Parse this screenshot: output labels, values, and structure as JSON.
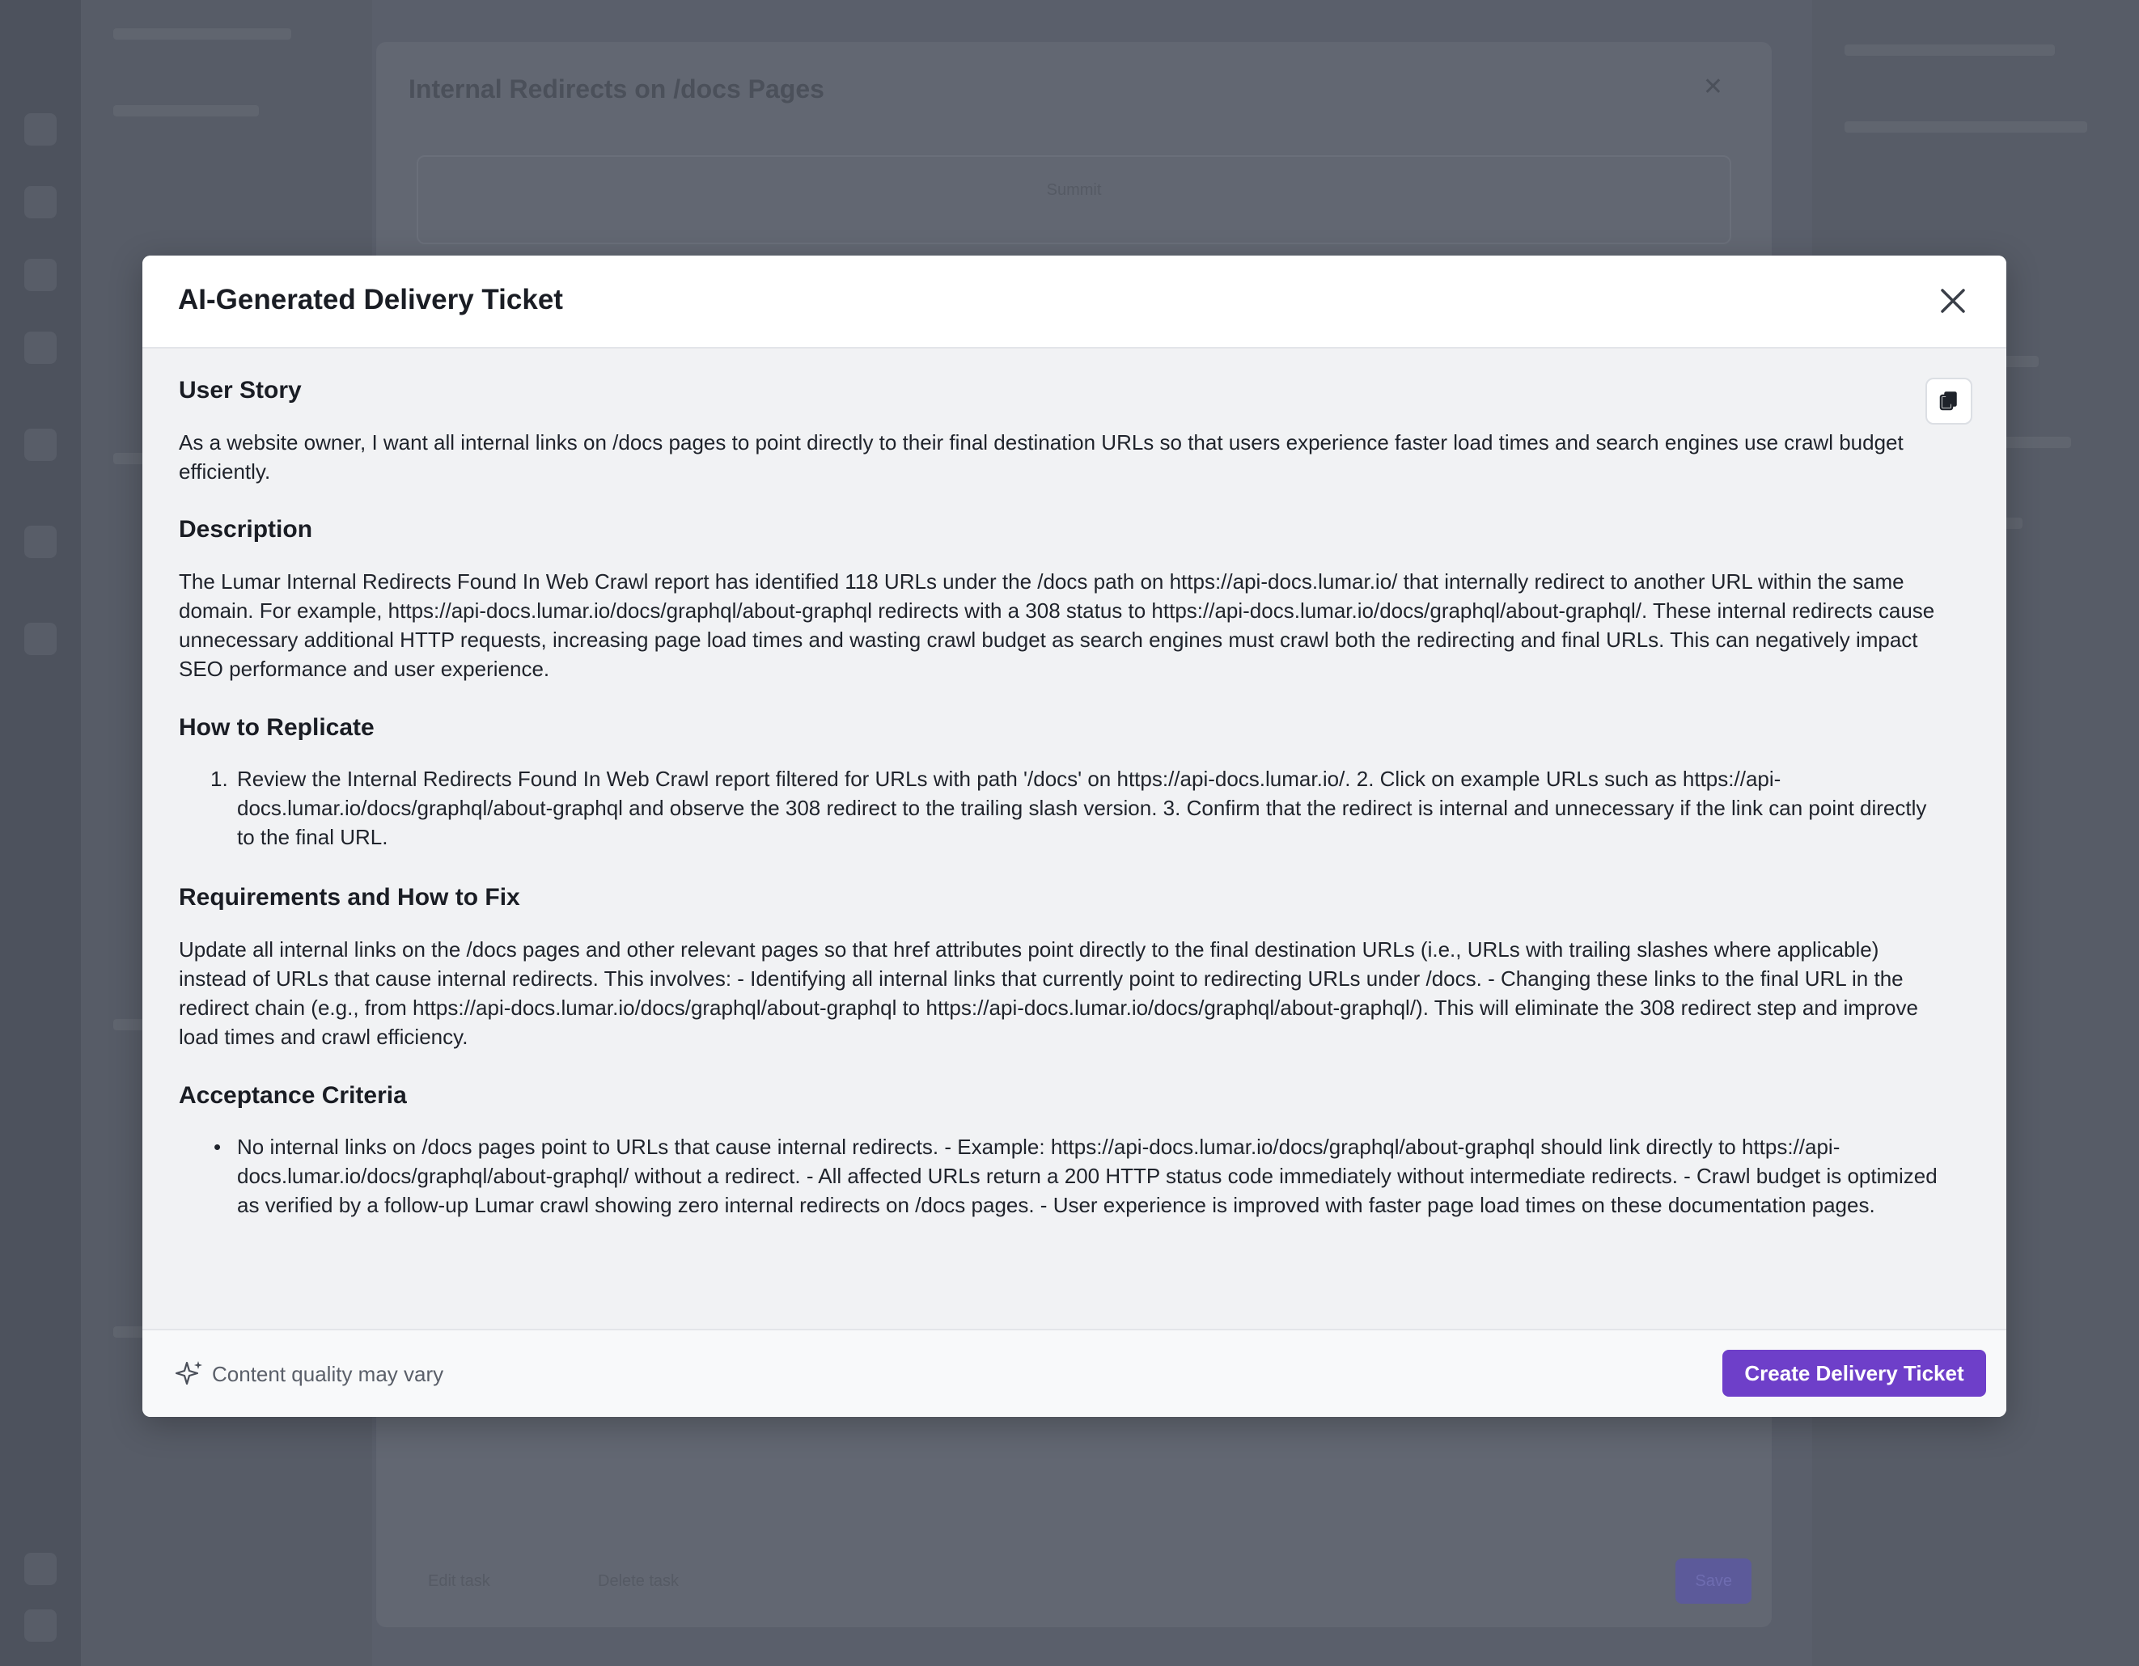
{
  "background": {
    "dialog_title": "Internal Redirects on /docs Pages",
    "box_label": "Summit",
    "edit_label": "Edit task",
    "delete_label": "Delete task",
    "primary_label": "Save"
  },
  "modal": {
    "title": "AI-Generated Delivery Ticket",
    "close_icon": "close-icon",
    "copy_icon": "copy-icon"
  },
  "sections": {
    "user_story": {
      "heading": "User Story",
      "text": "As a website owner, I want all internal links on /docs pages to point directly to their final destination URLs so that users experience faster load times and search engines use crawl budget efficiently."
    },
    "description": {
      "heading": "Description",
      "text": "The Lumar Internal Redirects Found In Web Crawl report has identified 118 URLs under the /docs path on https://api-docs.lumar.io/ that internally redirect to another URL within the same domain. For example, https://api-docs.lumar.io/docs/graphql/about-graphql redirects with a 308 status to https://api-docs.lumar.io/docs/graphql/about-graphql/. These internal redirects cause unnecessary additional HTTP requests, increasing page load times and wasting crawl budget as search engines must crawl both the redirecting and final URLs. This can negatively impact SEO performance and user experience."
    },
    "replicate": {
      "heading": "How to Replicate",
      "marker": "1.",
      "text": "Review the Internal Redirects Found In Web Crawl report filtered for URLs with path '/docs' on https://api-docs.lumar.io/. 2. Click on example URLs such as https://api-docs.lumar.io/docs/graphql/about-graphql and observe the 308 redirect to the trailing slash version. 3. Confirm that the redirect is internal and unnecessary if the link can point directly to the final URL."
    },
    "requirements": {
      "heading": "Requirements and How to Fix",
      "text": "Update all internal links on the /docs pages and other relevant pages so that href attributes point directly to the final destination URLs (i.e., URLs with trailing slashes where applicable) instead of URLs that cause internal redirects. This involves: - Identifying all internal links that currently point to redirecting URLs under /docs. - Changing these links to the final URL in the redirect chain (e.g., from https://api-docs.lumar.io/docs/graphql/about-graphql to https://api-docs.lumar.io/docs/graphql/about-graphql/). This will eliminate the 308 redirect step and improve load times and crawl efficiency."
    },
    "acceptance": {
      "heading": "Acceptance Criteria",
      "marker": "•",
      "text": "No internal links on /docs pages point to URLs that cause internal redirects. - Example: https://api-docs.lumar.io/docs/graphql/about-graphql should link directly to https://api-docs.lumar.io/docs/graphql/about-graphql/ without a redirect. - All affected URLs return a 200 HTTP status code immediately without intermediate redirects. - Crawl budget is optimized as verified by a follow-up Lumar crawl showing zero internal redirects on /docs pages. - User experience is improved with faster page load times on these documentation pages."
    }
  },
  "footer": {
    "note": "Content quality may vary",
    "note_icon": "sparkle-icon",
    "create_label": "Create Delivery Ticket"
  },
  "colors": {
    "accent": "#6e3fc9",
    "overlay": "#5a5f6b"
  }
}
